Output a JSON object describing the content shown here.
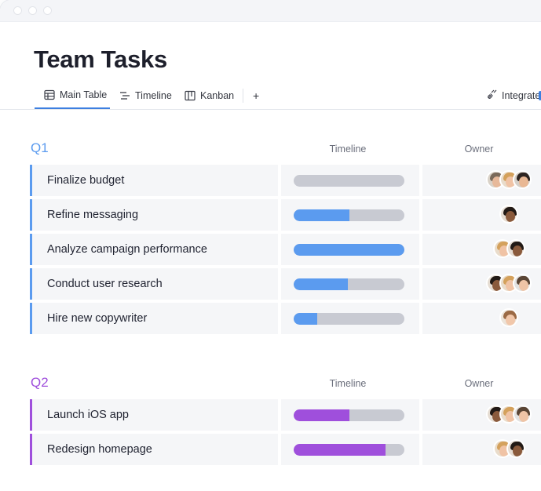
{
  "page": {
    "title": "Team Tasks"
  },
  "tabs": [
    {
      "label": "Main Table",
      "icon": "table-icon",
      "active": true
    },
    {
      "label": "Timeline",
      "icon": "timeline-icon",
      "active": false
    },
    {
      "label": "Kanban",
      "icon": "kanban-icon",
      "active": false
    }
  ],
  "add_tab_label": "+",
  "integrate": {
    "label": "Integrate",
    "icon": "integrate-icon"
  },
  "colors": {
    "q1_accent": "#5b9bef",
    "q2_accent": "#9f4fdc",
    "bar_track": "#c8cad2",
    "active_tab": "#3d7fe0"
  },
  "groups": [
    {
      "title": "Q1",
      "color": "#5b9bef",
      "columns": {
        "timeline": "Timeline",
        "owner": "Owner"
      },
      "rows": [
        {
          "name": "Finalize budget",
          "progress": 0.0,
          "owners": [
            "man-beard",
            "woman-blonde",
            "woman-dark"
          ]
        },
        {
          "name": "Refine messaging",
          "progress": 0.5,
          "owners": [
            "man-dark"
          ]
        },
        {
          "name": "Analyze campaign performance",
          "progress": 1.0,
          "owners": [
            "woman-blonde",
            "man-dark"
          ]
        },
        {
          "name": "Conduct user research",
          "progress": 0.49,
          "owners": [
            "man-dark",
            "woman-blonde",
            "man-light"
          ]
        },
        {
          "name": "Hire new copywriter",
          "progress": 0.21,
          "owners": [
            "woman-brown"
          ]
        }
      ]
    },
    {
      "title": "Q2",
      "color": "#9f4fdc",
      "columns": {
        "timeline": "Timeline",
        "owner": "Owner"
      },
      "rows": [
        {
          "name": "Launch iOS app",
          "progress": 0.5,
          "owners": [
            "man-dark",
            "woman-blonde",
            "man-light"
          ]
        },
        {
          "name": "Redesign homepage",
          "progress": 0.83,
          "owners": [
            "woman-blonde",
            "man-dark"
          ]
        }
      ]
    }
  ]
}
